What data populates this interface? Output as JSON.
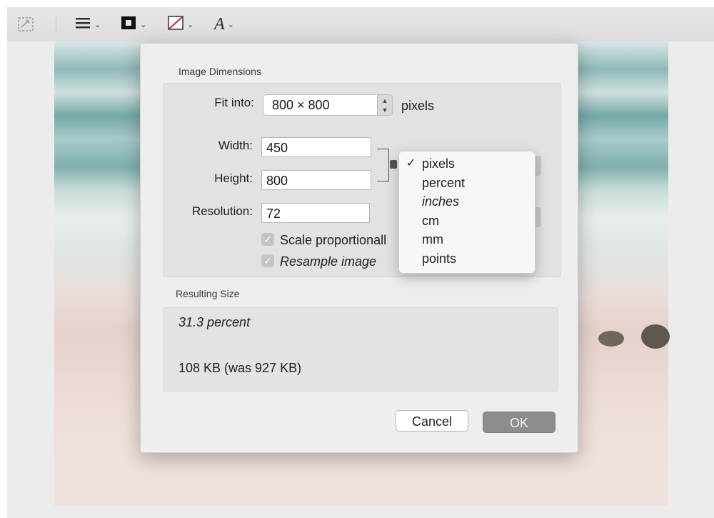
{
  "toolbar": {
    "items": [
      {
        "name": "adjust-size-icon",
        "glyph": "⤡"
      },
      {
        "name": "lines-menu-icon",
        "glyph": "☰"
      },
      {
        "name": "border-style-icon",
        "glyph": "▣"
      },
      {
        "name": "fill-color-icon",
        "glyph": "◩"
      },
      {
        "name": "text-style-icon",
        "glyph": "A"
      }
    ],
    "chevron": "⌄"
  },
  "dialog": {
    "image_dimensions_label": "Image Dimensions",
    "fit_into_label": "Fit into:",
    "fit_into_value": "800 × 800",
    "fit_into_unit": "pixels",
    "width_label": "Width:",
    "width_value": "450",
    "height_label": "Height:",
    "height_value": "800",
    "resolution_label": "Resolution:",
    "resolution_value": "72",
    "scale_label": "Scale proportionall",
    "resample_label": "Resample image",
    "resulting_size_label": "Resulting Size",
    "result_percent": "31.3 percent",
    "result_size": "108 KB (was 927 KB)",
    "cancel_label": "Cancel",
    "ok_label": "OK"
  },
  "units_menu": {
    "items": [
      "pixels",
      "percent",
      "inches",
      "cm",
      "mm",
      "points"
    ],
    "selected": "pixels",
    "check_glyph": "✓"
  }
}
